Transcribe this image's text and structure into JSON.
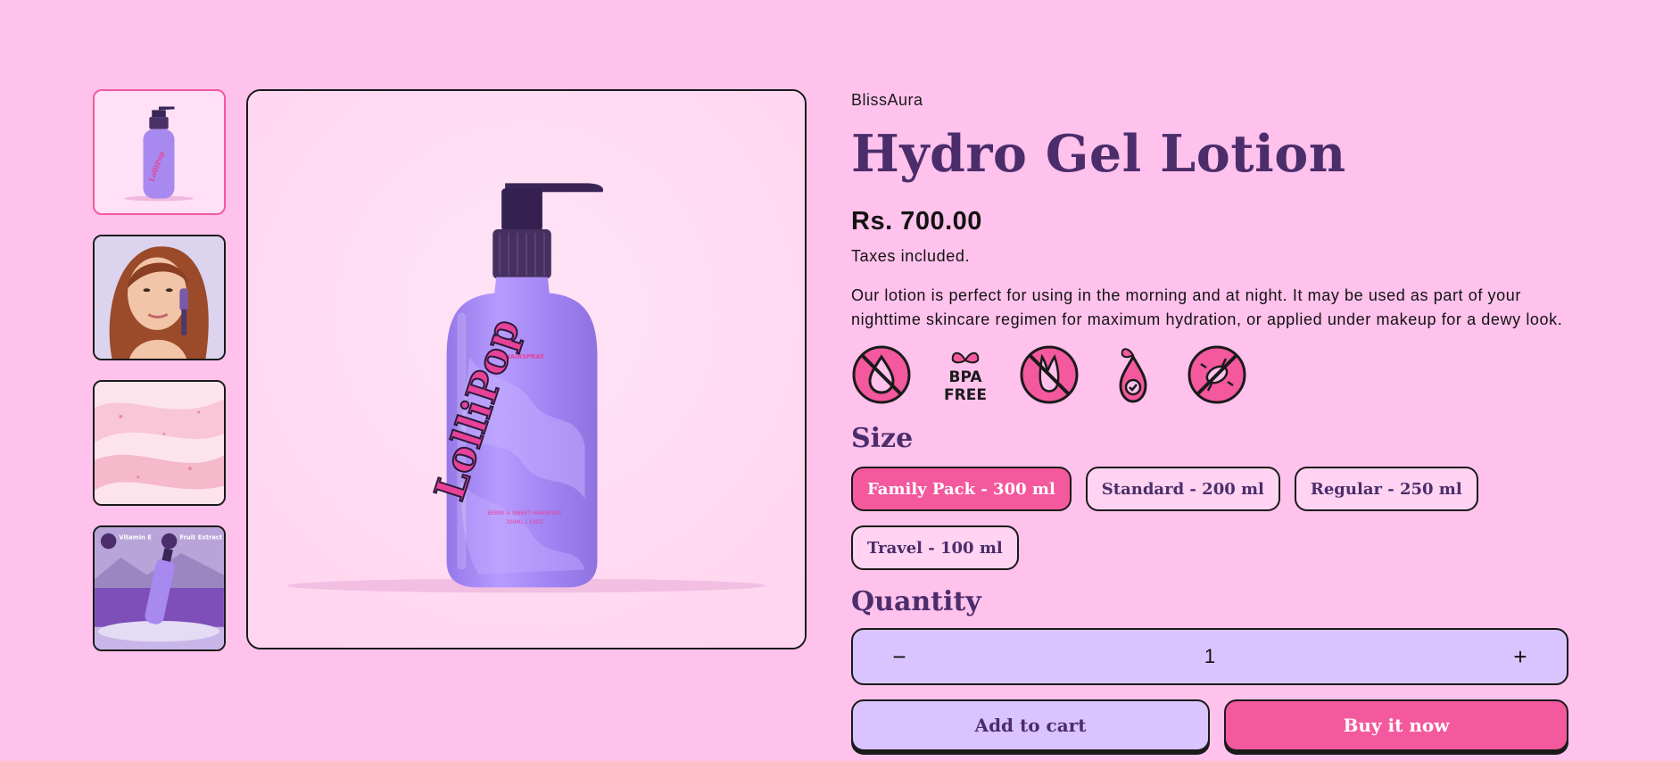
{
  "product": {
    "vendor": "BlissAura",
    "title": "Hydro Gel Lotion",
    "price": "Rs. 700.00",
    "tax_note": "Taxes included.",
    "description": "Our lotion is perfect for using in the morning and at night. It may be used as part of your nighttime skincare regimen for maximum hydration, or applied under makeup for a dewy look.",
    "bottle_brand": "LolliPop",
    "bottle_top_text": "HAIRSPRAY",
    "bottle_bottom_text": "BERRY & SWEET HAIRSPRAY",
    "bottle_volume_text": "300ML / 10OZ"
  },
  "badges": [
    {
      "icon": "no-oil-icon"
    },
    {
      "icon": "bpa-free-icon",
      "line1": "BPA",
      "line2": "FREE"
    },
    {
      "icon": "cruelty-free-icon"
    },
    {
      "icon": "natural-drop-icon"
    },
    {
      "icon": "no-bacteria-icon"
    }
  ],
  "size": {
    "label": "Size",
    "options": [
      "Family Pack - 300 ml",
      "Standard - 200 ml",
      "Regular - 250 ml",
      "Travel - 100 ml"
    ],
    "selected": "Family Pack - 300 ml"
  },
  "quantity": {
    "label": "Quantity",
    "value": "1",
    "decrease": "−",
    "increase": "+"
  },
  "actions": {
    "add_to_cart": "Add to cart",
    "buy_now": "Buy it now"
  },
  "thumbnail_labels": {
    "t4_left": "Vitamin E",
    "t4_right": "Fruit Extract"
  },
  "colors": {
    "background": "#ffc2ec",
    "accent_pink": "#f4589d",
    "lavender": "#d9c4ff",
    "heading_purple": "#4b2d6b"
  }
}
